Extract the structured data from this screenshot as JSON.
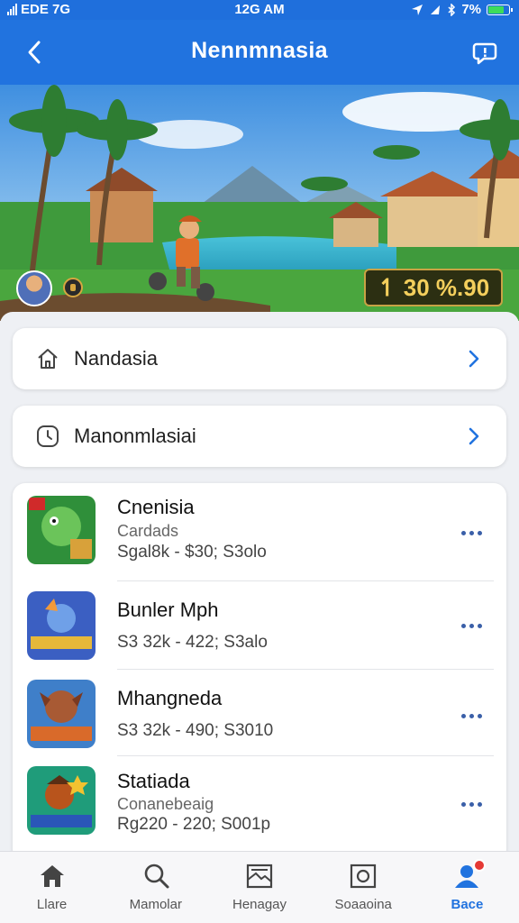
{
  "status_bar": {
    "carrier": "EDE 7G",
    "time": "12G AM",
    "battery": "7%",
    "battery_level": 0.7
  },
  "header": {
    "title": "Nennmnasia",
    "back_icon": "chevron-left-icon",
    "action_icon": "chat-bubble-icon"
  },
  "hero": {
    "price": "↿ 30 %.90"
  },
  "nav_cards": [
    {
      "label": "Nandasia",
      "icon": "home-icon"
    },
    {
      "label": "Manonmlasiai",
      "icon": "clock-icon"
    }
  ],
  "games": [
    {
      "name": "Cnenisia",
      "subtitle": "Cardads",
      "meta": "Sgal8k - $30; S3olo",
      "thumb_color": "#2f8f3a"
    },
    {
      "name": "Bunler Mph",
      "subtitle": "",
      "meta": "S3 32k - 422; S3alo",
      "thumb_color": "#3b5fc2"
    },
    {
      "name": "Mhangneda",
      "subtitle": "",
      "meta": "S3 32k - 490; S3010",
      "thumb_color": "#8a3a2a"
    },
    {
      "name": "Statiada",
      "subtitle": "Conanebeaig",
      "meta": "Rg220 - 220; S001p",
      "thumb_color": "#b8541c"
    }
  ],
  "tabs": [
    {
      "label": "Llare",
      "icon": "home-icon",
      "active": false
    },
    {
      "label": "Mamolar",
      "icon": "search-icon",
      "active": false
    },
    {
      "label": "Henagay",
      "icon": "image-icon",
      "active": false
    },
    {
      "label": "Soaaoina",
      "icon": "camera-icon",
      "active": false
    },
    {
      "label": "Bace",
      "icon": "profile-icon",
      "active": true
    }
  ],
  "colors": {
    "primary": "#2173df",
    "accent_gold": "#f4cf5c",
    "more_dots": "#3a5fa8"
  }
}
